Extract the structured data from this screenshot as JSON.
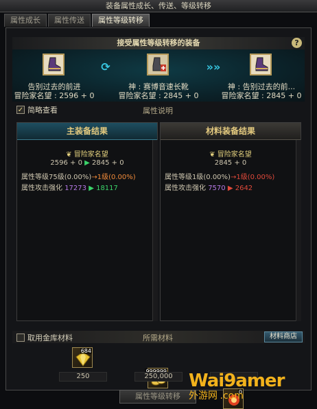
{
  "window": {
    "title": "装备属性成长、传送、等级转移"
  },
  "tabs": [
    {
      "label": "属性成长"
    },
    {
      "label": "属性传送"
    },
    {
      "label": "属性等级转移"
    }
  ],
  "header": {
    "title": "接受属性等级转移的装备",
    "help": "?"
  },
  "items": {
    "left": {
      "name": "告别过去的前进",
      "sub": "冒险家名望 : 2596 + 0"
    },
    "middle": {
      "name": "神 : 赛博音速长靴",
      "sub": "冒险家名望 : 2845 + 0"
    },
    "right": {
      "name": "神 : 告别过去的前...",
      "sub": "冒险家名望 : 2845 + 0"
    }
  },
  "controls": {
    "simple_view": "简略查看",
    "attr_desc": "属性说明",
    "checked": "✓"
  },
  "main_result": {
    "title": "主装备结果",
    "fame_label": "冒险家名望",
    "fame_from": "2596 + 0",
    "fame_to": "2845 + 0",
    "level_prefix": "属性等级75级",
    "level_pct": "(0.00%)",
    "level_arrow": "→",
    "level_to": "1级(0.00%)",
    "attack_label": "属性攻击强化",
    "attack_from": "17273",
    "attack_to": "18117"
  },
  "mat_result": {
    "title": "材料装备结果",
    "fame_label": "冒险家名望",
    "fame_value": "2845 + 0",
    "level_prefix": "属性等级1级",
    "level_pct": "(0.00%)",
    "level_arrow": "→",
    "level_to": "1级(0.00%)",
    "attack_label": "属性攻击强化",
    "attack_from": "7570",
    "attack_to": "2642"
  },
  "materials": {
    "use_vault": "取用金库材料",
    "required": "所需材料",
    "shop": "材料商店",
    "list": [
      {
        "icon": "crystal-icon",
        "badge": "684",
        "value": "250"
      },
      {
        "icon": "gold-coins-icon",
        "badge": "999999",
        "value": "250,000"
      },
      {
        "icon": "burst-icon",
        "badge": "0",
        "value": ""
      }
    ]
  },
  "action": {
    "label": "属性等级转移"
  },
  "watermark": {
    "brand": "Wai9amer",
    "sub": "外游网",
    "domain": ".com"
  },
  "colors": {
    "accent": "#38c6e0",
    "gold": "#e4ca7f",
    "green": "#3bd46a"
  }
}
